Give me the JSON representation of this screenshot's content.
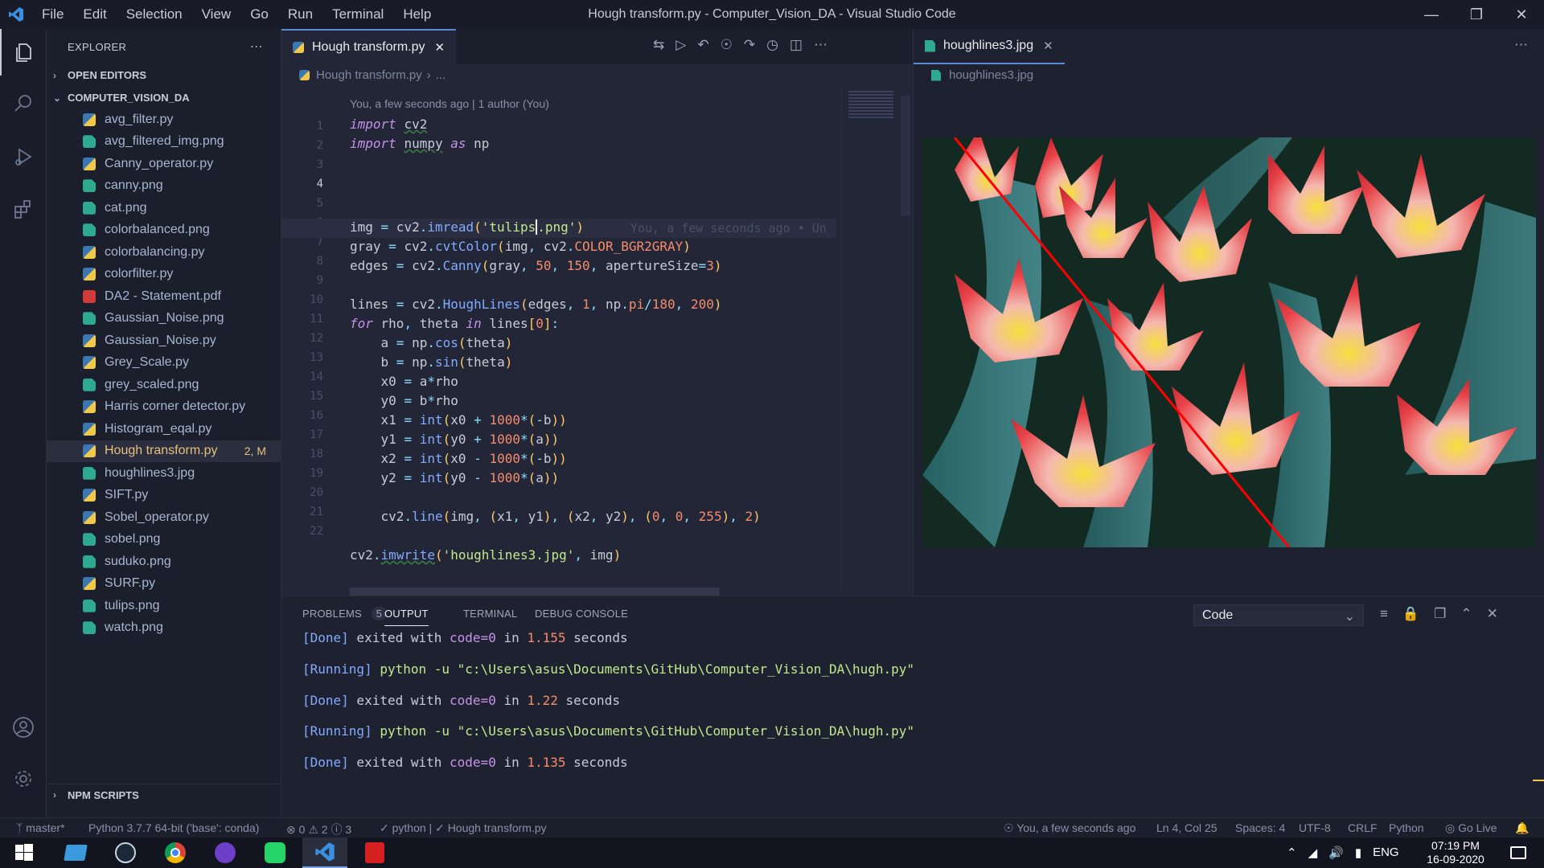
{
  "titlebar": {
    "menu": [
      "File",
      "Edit",
      "Selection",
      "View",
      "Go",
      "Run",
      "Terminal",
      "Help"
    ],
    "title": "Hough transform.py - Computer_Vision_DA - Visual Studio Code"
  },
  "sidebar": {
    "header": "EXPLORER",
    "open_editors": "OPEN EDITORS",
    "project": "COMPUTER_VISION_DA",
    "files": [
      {
        "name": "avg_filter.py",
        "type": "py"
      },
      {
        "name": "avg_filtered_img.png",
        "type": "img"
      },
      {
        "name": "Canny_operator.py",
        "type": "py"
      },
      {
        "name": "canny.png",
        "type": "img"
      },
      {
        "name": "cat.png",
        "type": "img"
      },
      {
        "name": "colorbalanced.png",
        "type": "img"
      },
      {
        "name": "colorbalancing.py",
        "type": "py"
      },
      {
        "name": "colorfilter.py",
        "type": "py"
      },
      {
        "name": "DA2 - Statement.pdf",
        "type": "pdf"
      },
      {
        "name": "Gaussian_Noise.png",
        "type": "img"
      },
      {
        "name": "Gaussian_Noise.py",
        "type": "py"
      },
      {
        "name": "Grey_Scale.py",
        "type": "py"
      },
      {
        "name": "grey_scaled.png",
        "type": "img"
      },
      {
        "name": "Harris corner detector.py",
        "type": "py"
      },
      {
        "name": "Histogram_eqal.py",
        "type": "py"
      },
      {
        "name": "Hough transform.py",
        "type": "py",
        "badge": "2, M"
      },
      {
        "name": "houghlines3.jpg",
        "type": "img"
      },
      {
        "name": "SIFT.py",
        "type": "py"
      },
      {
        "name": "Sobel_operator.py",
        "type": "py"
      },
      {
        "name": "sobel.png",
        "type": "img"
      },
      {
        "name": "suduko.png",
        "type": "img"
      },
      {
        "name": "SURF.py",
        "type": "py"
      },
      {
        "name": "tulips.png",
        "type": "img"
      },
      {
        "name": "watch.png",
        "type": "img"
      }
    ],
    "npm": "NPM SCRIPTS"
  },
  "editor": {
    "tab": "Hough transform.py",
    "breadcrumb": "Hough transform.py",
    "breadcrumb_more": "...",
    "blame_header": "You, a few seconds ago | 1 author (You)",
    "inline_blame": "You, a few seconds ago • Un",
    "line_numbers": [
      "1",
      "2",
      "3",
      "4",
      "5",
      "6",
      "7",
      "8",
      "9",
      "10",
      "11",
      "12",
      "13",
      "14",
      "15",
      "16",
      "17",
      "18",
      "19",
      "20",
      "21",
      "22"
    ]
  },
  "image_pane": {
    "tab": "houghlines3.jpg",
    "breadcrumb": "houghlines3.jpg"
  },
  "panel": {
    "tabs": {
      "problems": "PROBLEMS",
      "problems_count": "5",
      "output": "OUTPUT",
      "terminal": "TERMINAL",
      "debug": "DEBUG CONSOLE"
    },
    "channel": "Code",
    "lines": [
      {
        "kind": "done",
        "tag": "[Done]",
        "text": " exited with ",
        "code": "code=0",
        "in": " in ",
        "time": "1.155",
        "unit": " seconds"
      },
      {
        "kind": "run",
        "tag": "[Running]",
        "text": " python -u \"c:\\Users\\asus\\Documents\\GitHub\\Computer_Vision_DA\\hugh.py\""
      },
      {
        "kind": "done",
        "tag": "[Done]",
        "text": " exited with ",
        "code": "code=0",
        "in": " in ",
        "time": "1.22",
        "unit": " seconds"
      },
      {
        "kind": "run",
        "tag": "[Running]",
        "text": " python -u \"c:\\Users\\asus\\Documents\\GitHub\\Computer_Vision_DA\\hugh.py\""
      },
      {
        "kind": "done",
        "tag": "[Done]",
        "text": " exited with ",
        "code": "code=0",
        "in": " in ",
        "time": "1.135",
        "unit": " seconds"
      }
    ]
  },
  "status": {
    "branch": "master*",
    "interpreter": "Python 3.7.7 64-bit ('base': conda)",
    "errors": "0",
    "warnings": "2",
    "infos": "3",
    "checks": "✓ python | ✓ Hough transform.py",
    "blame": "You, a few seconds ago",
    "position": "Ln 4, Col 25",
    "spaces": "Spaces: 4",
    "encoding": "UTF-8",
    "eol": "CRLF",
    "language": "Python",
    "golive": "Go Live"
  },
  "taskbar": {
    "lang": "ENG",
    "time": "07:19 PM",
    "date": "16-09-2020"
  },
  "colors": {
    "accent": "#5a8bd6",
    "modified": "#e6c07b",
    "background": "#222636"
  }
}
